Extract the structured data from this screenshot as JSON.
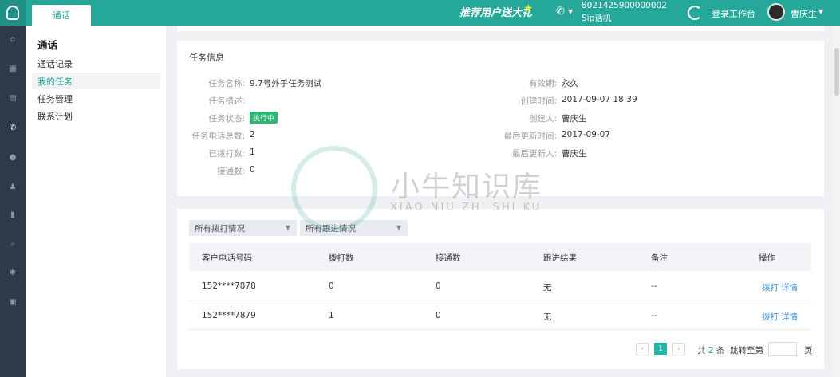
{
  "topbar": {
    "tab_label": "通话",
    "promo_text": "推荐用户送大礼",
    "sip_number": "8021425900000002",
    "sip_label": "Sip话机",
    "login_label": "登录工作台",
    "user_name": "曹庆生",
    "accent_color": "#25a79a"
  },
  "rail": {
    "items": [
      "home-icon",
      "grid-icon",
      "book-icon",
      "phone-icon",
      "user-icon",
      "users-icon",
      "chart-icon",
      "search-icon",
      "gear-icon",
      "box-icon"
    ],
    "active_index": 3
  },
  "sidebar": {
    "title": "通话",
    "items": [
      {
        "label": "通话记录",
        "active": false
      },
      {
        "label": "我的任务",
        "active": true
      },
      {
        "label": "任务管理",
        "active": false
      },
      {
        "label": "联系计划",
        "active": false
      }
    ]
  },
  "task_info": {
    "section_title": "任务信息",
    "left": [
      {
        "label": "任务名称:",
        "value": "9.7号外乎任务测试"
      },
      {
        "label": "任务描述:",
        "value": ""
      },
      {
        "label": "任务状态:",
        "value": "执行中"
      },
      {
        "label": "任务电话总数:",
        "value": "2"
      },
      {
        "label": "已拨打数:",
        "value": "1"
      },
      {
        "label": "接通数:",
        "value": "0"
      }
    ],
    "right": [
      {
        "label": "有效期:",
        "value": "永久"
      },
      {
        "label": "创建时间:",
        "value": "2017-09-07 18:39"
      },
      {
        "label": "创建人:",
        "value": "曹庆生"
      },
      {
        "label": "最后更新时间:",
        "value": "2017-09-07"
      },
      {
        "label": "最后更新人:",
        "value": "曹庆生"
      }
    ]
  },
  "filters": [
    {
      "label": "所有拨打情况"
    },
    {
      "label": "所有跟进情况"
    }
  ],
  "table": {
    "columns": [
      "客户电话号码",
      "拨打数",
      "接通数",
      "跟进结果",
      "备注",
      "操作"
    ],
    "rows": [
      {
        "phone": "152****7878",
        "dialed": "0",
        "connected": "0",
        "result": "无",
        "note": "--",
        "action_dial": "拨打",
        "action_detail": "详情"
      },
      {
        "phone": "152****7879",
        "dialed": "1",
        "connected": "0",
        "result": "无",
        "note": "--",
        "action_dial": "拨打",
        "action_detail": "详情"
      }
    ]
  },
  "pagination": {
    "prev": "‹",
    "current_page": "1",
    "next": "›",
    "total_prefix": "共",
    "total_count": "2",
    "total_suffix": "条",
    "jump_label": "跳转至第",
    "page_suffix": "页"
  },
  "watermark": {
    "title": "小牛知识库",
    "subtitle": "XIAO NIU ZHI SHI KU"
  }
}
